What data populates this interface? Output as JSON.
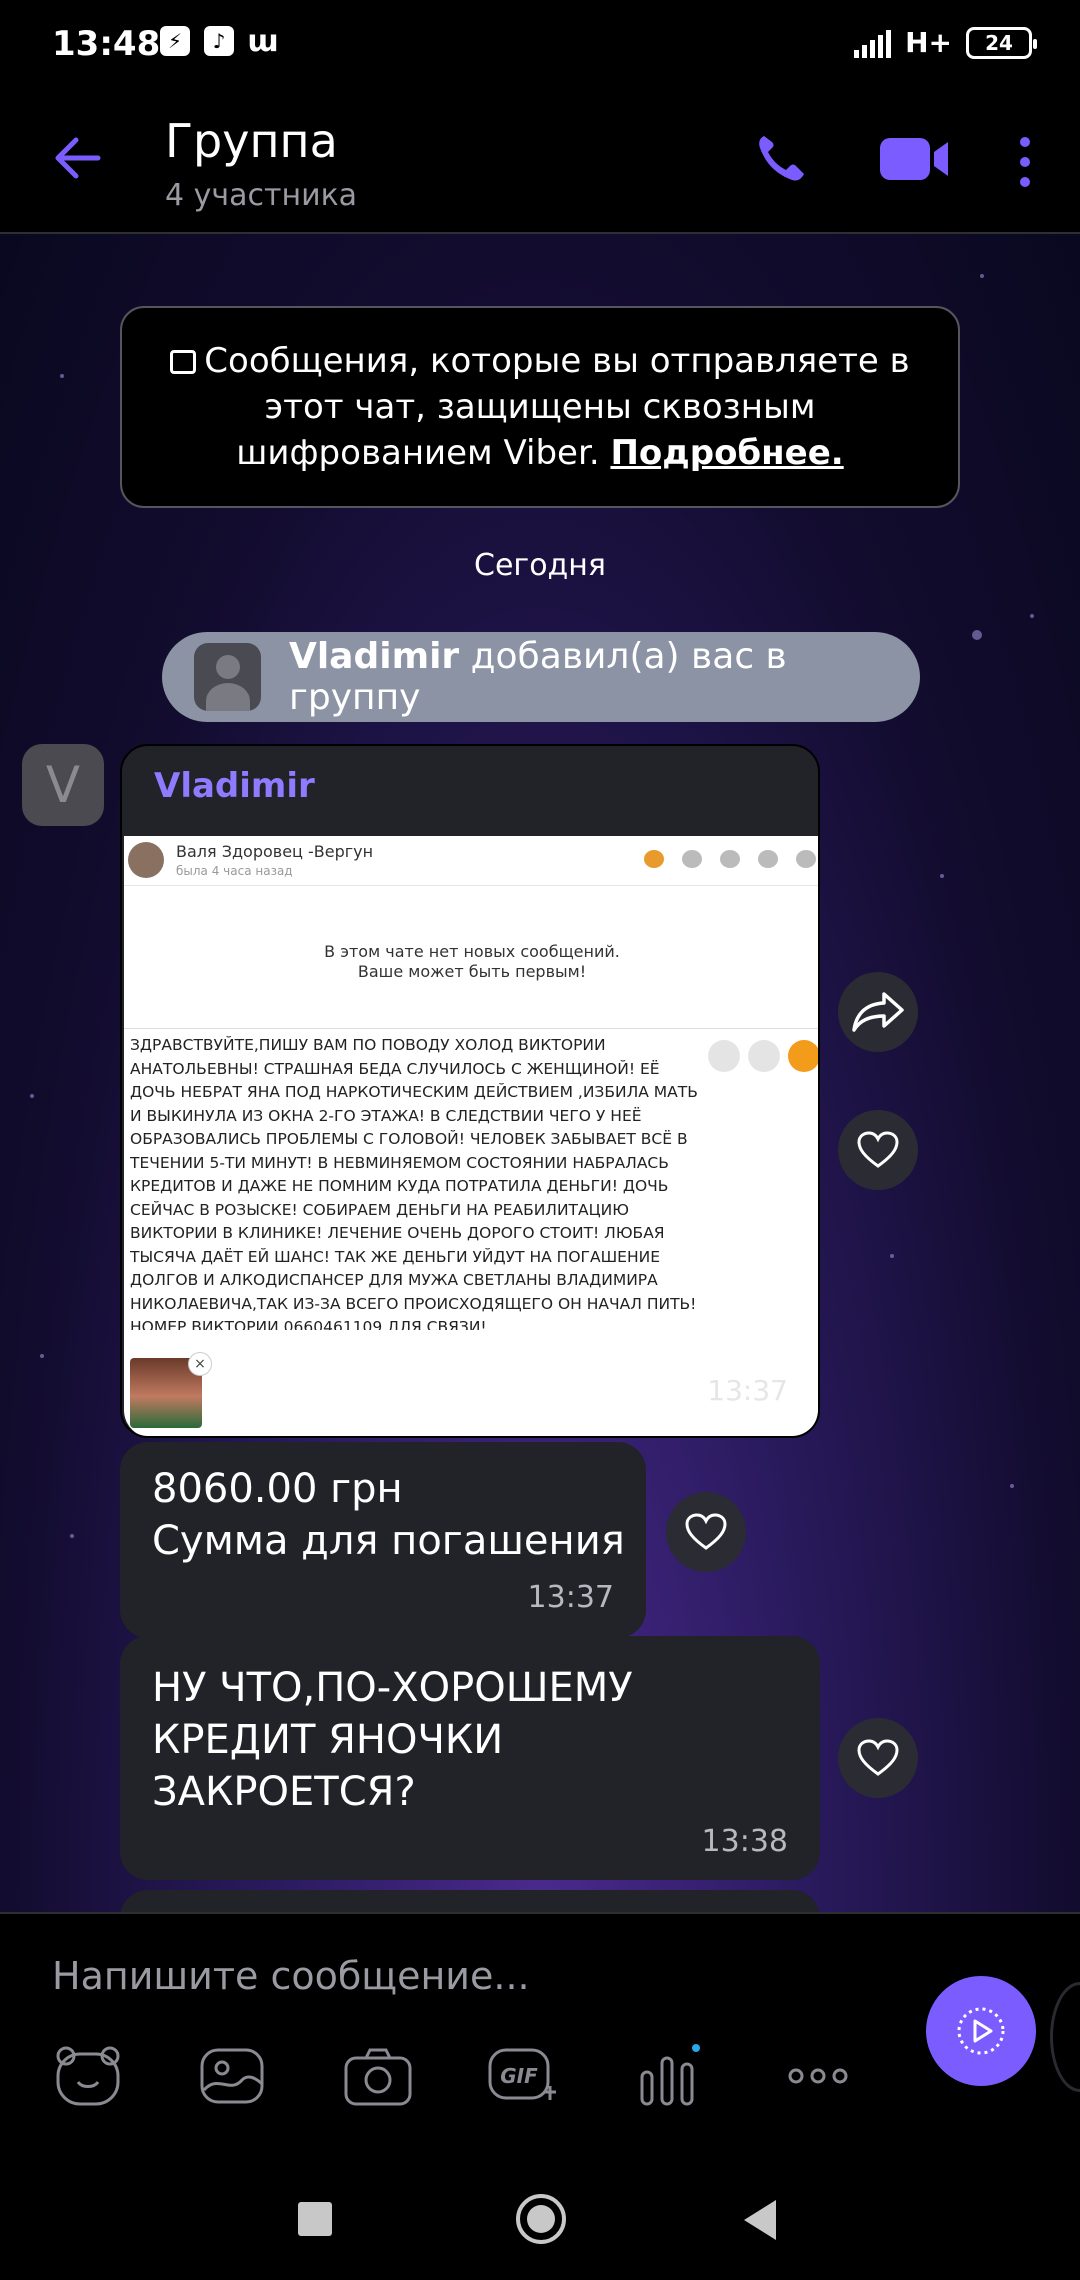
{
  "status_bar": {
    "time": "13:48",
    "network": "H+",
    "battery": "24"
  },
  "header": {
    "title": "Группа",
    "subtitle": "4 участника"
  },
  "encryption_notice": {
    "text": "Сообщения, которые вы отправляете в этот чат, защищены сквозным шифрованием Viber.",
    "link": "Подробнее."
  },
  "date_divider": "Сегодня",
  "system_message": {
    "name": "Vladimir",
    "text": "добавил(а) вас в группу"
  },
  "messages": [
    {
      "sender": "Vladimir",
      "avatar_letter": "V",
      "time": "13:37",
      "screenshot": {
        "contact_name": "Валя Здоровец -Вергун",
        "contact_status": "была 4 часа назад",
        "empty_line1": "В этом чате нет новых сообщений.",
        "empty_line2": "Ваше может быть первым!",
        "draft_text": "ЗДРАВСТВУЙТЕ,ПИШУ ВАМ ПО ПОВОДУ ХОЛОД ВИКТОРИИ АНАТОЛЬЕВНЫ! СТРАШНАЯ БЕДА СЛУЧИЛОСЬ С ЖЕНЩИНОЙ! ЕЁ ДОЧЬ НЕБРАТ ЯНА ПОД НАРКОТИЧЕСКИМ ДЕЙСТВИЕМ ,ИЗБИЛА МАТЬ И ВЫКИНУЛА ИЗ ОКНА 2-ГО ЭТАЖА! В СЛЕДСТВИИ ЧЕГО У НЕЁ ОБРАЗОВАЛИСЬ ПРОБЛЕМЫ С ГОЛОВОЙ! ЧЕЛОВЕК ЗАБЫВАЕТ ВСЁ В ТЕЧЕНИИ 5-ТИ МИНУТ! В НЕВМИНЯЕМОМ СОСТОЯНИИ НАБРАЛАСЬ КРЕДИТОВ И ДАЖЕ НЕ ПОМНИМ КУДА ПОТРАТИЛА ДЕНЬГИ! ДОЧЬ СЕЙЧАС В РОЗЫСКЕ! СОБИРАЕМ ДЕНЬГИ НА РЕАБИЛИТАЦИЮ ВИКТОРИИ В КЛИНИКЕ! ЛЕЧЕНИЕ ОЧЕНЬ ДОРОГО СТОИТ! ЛЮБАЯ ТЫСЯЧА ДАЁТ ЕЙ ШАНС! ТАК ЖЕ ДЕНЬГИ УЙДУТ НА ПОГАШЕНИЕ ДОЛГОВ И АЛКОДИСПАНСЕР ДЛЯ МУЖА СВЕТЛАНЫ ВЛАДИМИРА НИКОЛАЕВИЧА,ТАК ИЗ-ЗА ВСЕГО ПРОИСХОДЯЩЕГО ОН НАЧАЛ ПИТЬ! НОМЕР ВИКТОРИИ 0660461109 ДЛЯ СВЯЗИ!"
      }
    },
    {
      "line1": "8060.00 грн",
      "line2": "Сумма для погашения",
      "time": "13:37"
    },
    {
      "text": "НУ ЧТО,ПО-ХОРОШЕМУ КРЕДИТ ЯНОЧКИ ЗАКРОЕТСЯ?",
      "time": "13:38"
    }
  ],
  "composer": {
    "placeholder": "Напишите сообщение..."
  },
  "colors": {
    "accent": "#7b5cff",
    "sender_name": "#8f7bff",
    "bubble": "#222229",
    "system_pill": "#8b93a4"
  },
  "icons": [
    "back-arrow-icon",
    "phone-icon",
    "video-icon",
    "more-vertical-icon",
    "lock-icon",
    "share-icon",
    "heart-icon",
    "sticker-icon",
    "gallery-icon",
    "camera-icon",
    "gif-icon",
    "poll-icon",
    "more-horizontal-icon",
    "send-icon"
  ]
}
